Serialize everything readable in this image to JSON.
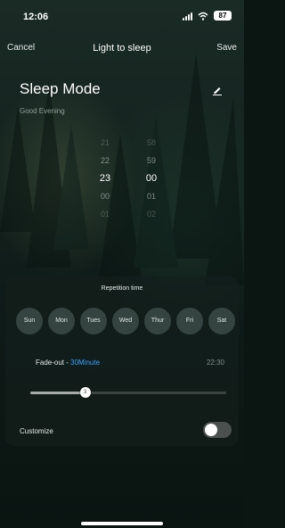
{
  "status_bar": {
    "time": "12:06",
    "battery": "87"
  },
  "nav": {
    "cancel_label": "Cancel",
    "title": "Light to sleep",
    "save_label": "Save"
  },
  "mode": {
    "title": "Sleep Mode",
    "greeting": "Good Evening"
  },
  "time_picker": {
    "hours": [
      "21",
      "22",
      "23",
      "00",
      "01"
    ],
    "minutes": [
      "58",
      "59",
      "00",
      "01",
      "02"
    ],
    "selected_hour": "23",
    "selected_minute": "00"
  },
  "repetition": {
    "title": "Repetition time",
    "days": [
      "Sun",
      "Mon",
      "Tues",
      "Wed",
      "Thur",
      "Fri",
      "Sat"
    ]
  },
  "fade": {
    "label": "Fade-out - ",
    "value": "30Minute",
    "end_time": "22:30",
    "slider_fraction": 0.28,
    "slider_thumb_label": "3"
  },
  "customize": {
    "label": "Customize",
    "enabled": false
  },
  "colors": {
    "accent": "#3ba3ff",
    "background": "#0b1612"
  },
  "icons": {
    "edit": "pencil-icon",
    "wifi": "wifi-icon",
    "signal": "signal-icon",
    "battery": "battery-icon"
  }
}
